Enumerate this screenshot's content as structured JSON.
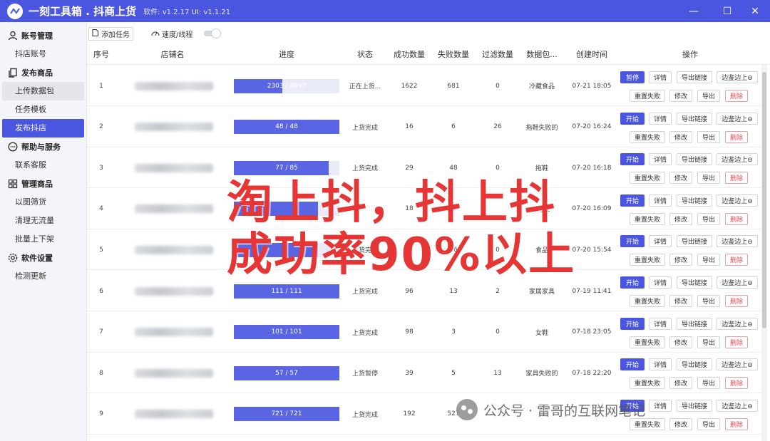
{
  "app": {
    "title": "一刻工具箱 . 抖商上货",
    "version": "软件: v1.2.17   UI: v1.1.21"
  },
  "window": {
    "min": "—",
    "max": "☐",
    "close": "✕"
  },
  "sidebar": {
    "groups": [
      {
        "label": "账号管理",
        "icon": "user-icon",
        "items": [
          {
            "label": "抖店账号"
          }
        ]
      },
      {
        "label": "发布商品",
        "icon": "copy-icon",
        "items": [
          {
            "label": "上传数据包"
          },
          {
            "label": "任务模板"
          },
          {
            "label": "发布抖店"
          }
        ]
      },
      {
        "label": "帮助与服务",
        "icon": "chat-icon",
        "items": [
          {
            "label": "联系客服"
          }
        ]
      },
      {
        "label": "管理商品",
        "icon": "grid-icon",
        "items": [
          {
            "label": "以图筛货"
          },
          {
            "label": "清理无流量"
          },
          {
            "label": "批量上下架"
          }
        ]
      },
      {
        "label": "软件设置",
        "icon": "gear-icon",
        "items": [
          {
            "label": "检测更新"
          }
        ]
      }
    ]
  },
  "toolbar": {
    "add_task": "添加任务",
    "speed": "速度/线程"
  },
  "table": {
    "headers": [
      "序号",
      "店铺名",
      "进度",
      "状态",
      "成功数量",
      "失败数量",
      "过滤数量",
      "数据包...",
      "创建时间",
      "操作"
    ],
    "rows": [
      {
        "idx": "1",
        "progress": "2303 / 4997",
        "pct": 0.46,
        "status": "正在上货...",
        "success": "1622",
        "fail": "681",
        "filter": "0",
        "pkg": "冷藏食品",
        "time": "07-21 18:05",
        "primary": "暂停"
      },
      {
        "idx": "2",
        "progress": "48 / 48",
        "pct": 1,
        "status": "上货完成",
        "success": "16",
        "fail": "6",
        "filter": "26",
        "pkg": "拖鞋失败的",
        "time": "07-20 16:24",
        "primary": "开始"
      },
      {
        "idx": "3",
        "progress": "77 / 85",
        "pct": 0.9,
        "status": "上货完成",
        "success": "29",
        "fail": "48",
        "filter": "0",
        "pkg": "拖鞋",
        "time": "07-20 16:18",
        "primary": "开始"
      },
      {
        "idx": "4",
        "progress": "",
        "pct": 0.8,
        "status": "",
        "success": "18",
        "fail": "8",
        "filter": "",
        "pkg": "食品2",
        "time": "07-20 16:09",
        "primary": "开始"
      },
      {
        "idx": "5",
        "progress": "",
        "pct": 0.8,
        "status": "上货完成",
        "success": "",
        "fail": "26",
        "filter": "0",
        "pkg": "食品",
        "time": "07-20 15:54",
        "primary": "开始"
      },
      {
        "idx": "6",
        "progress": "111 / 111",
        "pct": 1,
        "status": "上货完成",
        "success": "96",
        "fail": "13",
        "filter": "2",
        "pkg": "家居家具",
        "time": "07-19 11:41",
        "primary": "开始"
      },
      {
        "idx": "7",
        "progress": "101 / 101",
        "pct": 1,
        "status": "上货完成",
        "success": "98",
        "fail": "3",
        "filter": "0",
        "pkg": "女鞋",
        "time": "07-18 23:05",
        "primary": "开始"
      },
      {
        "idx": "8",
        "progress": "57 / 57",
        "pct": 1,
        "status": "上货暂停",
        "success": "39",
        "fail": "5",
        "filter": "13",
        "pkg": "家具失败的",
        "time": "07-18 22:20",
        "primary": "开始"
      },
      {
        "idx": "9",
        "progress": "721 / 721",
        "pct": 1,
        "status": "上货完成",
        "success": "192",
        "fail": "527",
        "filter": "",
        "pkg": "",
        "time": "",
        "primary": "开始"
      }
    ],
    "ops": {
      "detail": "详情",
      "export_link": "导出链接",
      "edge": "边鉴边上⊖",
      "reset_fail": "重置失败",
      "edit": "修改",
      "export": "导出",
      "delete": "删除"
    }
  },
  "overlay": {
    "line1": "淘上抖，抖上抖",
    "line2": "成功率90%以上"
  },
  "watermark": {
    "text": "公众号 · 雷哥的互联网笔记"
  },
  "colors": {
    "brand": "#4a55e0",
    "promo": "#e53535",
    "danger": "#e14b55"
  }
}
